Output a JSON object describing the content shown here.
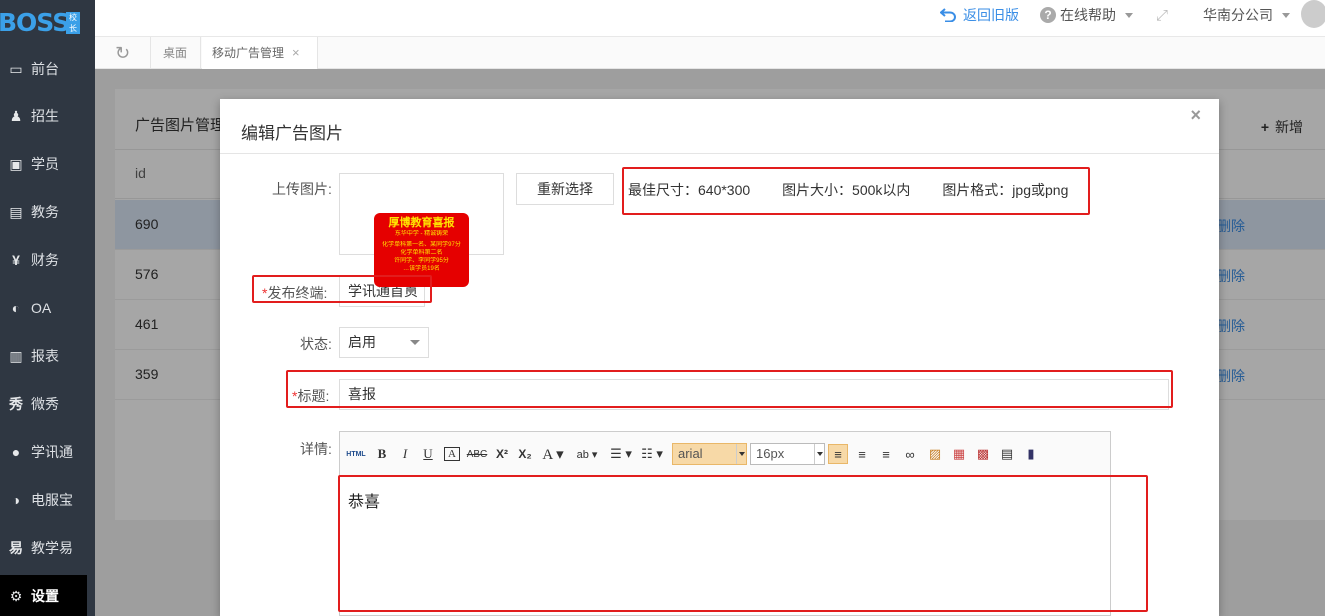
{
  "header": {
    "logo": "BOSS",
    "logo_badge": "校长",
    "back_old": "返回旧版",
    "online_help": "在线帮助",
    "company": "华南分公司"
  },
  "tabs": [
    {
      "label": "桌面"
    },
    {
      "label": "移动广告管理",
      "close": "×"
    }
  ],
  "sidebar": {
    "items": [
      {
        "label": "前台",
        "icon": "desk-icon"
      },
      {
        "label": "招生",
        "icon": "add-user-icon"
      },
      {
        "label": "学员",
        "icon": "student-card-icon"
      },
      {
        "label": "教务",
        "icon": "book-icon"
      },
      {
        "label": "财务",
        "icon": "yen-icon"
      },
      {
        "label": "OA",
        "icon": "oa-icon"
      },
      {
        "label": "报表",
        "icon": "bar-chart-icon"
      },
      {
        "label": "微秀",
        "icon": "weixiu-icon"
      },
      {
        "label": "学讯通",
        "icon": "location-icon"
      },
      {
        "label": "电服宝",
        "icon": "phone-icon"
      },
      {
        "label": "教学易",
        "icon": "teach-icon"
      },
      {
        "label": "设置",
        "icon": "gear-icon"
      }
    ]
  },
  "panel": {
    "title": "广告图片管理",
    "add": "新增",
    "column_id": "id",
    "rows": [
      {
        "id": "690",
        "action": "删除"
      },
      {
        "id": "576",
        "action": "删除"
      },
      {
        "id": "461",
        "action": "删除"
      },
      {
        "id": "359",
        "action": "删除"
      }
    ]
  },
  "modal": {
    "title": "编辑广告图片",
    "close": "×",
    "upload_label": "上传图片:",
    "reselect": "重新选择",
    "hint_size": "最佳尺寸：640*300",
    "hint_filesize": "图片大小：500k以内",
    "hint_format": "图片格式：jpg或png",
    "terminal_label": "发布终端:",
    "terminal_value": "学讯通首页",
    "status_label": "状态:",
    "status_value": "启用",
    "title_label": "标题:",
    "title_value": "喜报",
    "detail_label": "详情:",
    "editor_font": "arial",
    "editor_size": "16px",
    "editor_content": "恭喜",
    "thumb_title": "厚博教育喜报",
    "thumb_sub": "东华中学 - 精诚铸荣",
    "thumb_line1": "化学单科第一名、某同学97分",
    "thumb_line2": "化学单科第二名",
    "thumb_line3": "许同学、李同学95分",
    "thumb_line4": "…该学员19名"
  },
  "colors": {
    "sidebar_bg": "#2f3742",
    "accent": "#3a8ee6",
    "highlight_box": "#e21d1d"
  }
}
